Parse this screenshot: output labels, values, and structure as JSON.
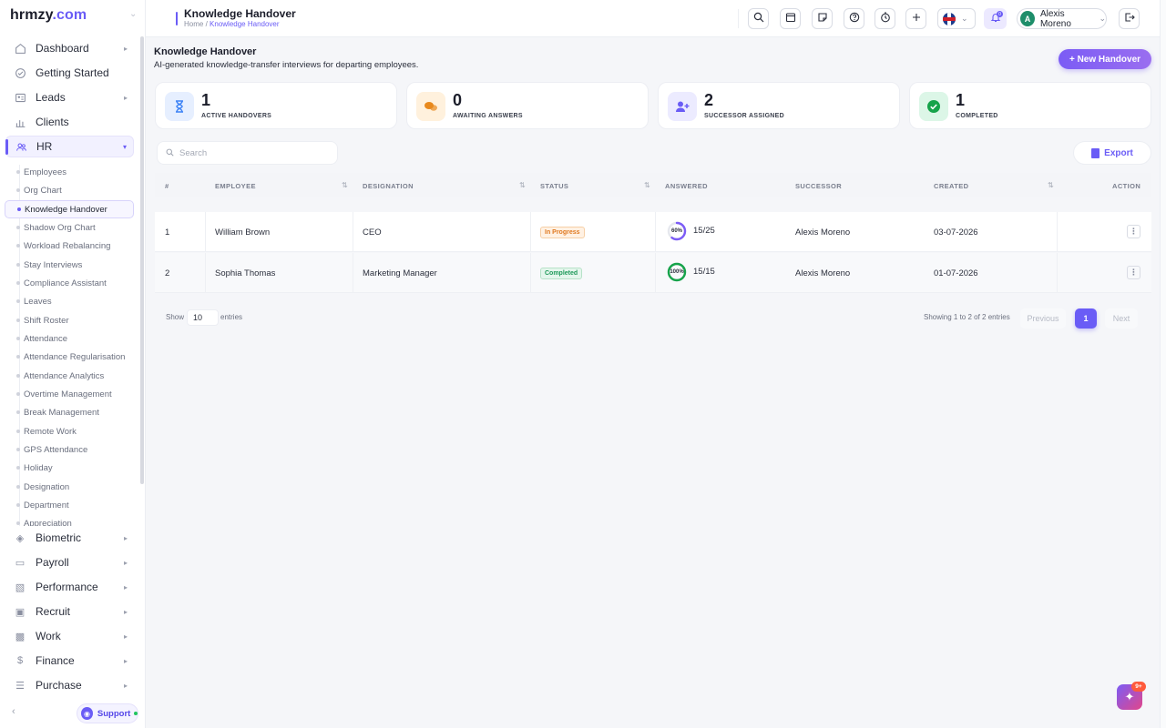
{
  "brand": {
    "name": "hrmzy",
    "suffix": ".com"
  },
  "header": {
    "title": "Knowledge Handover",
    "breadcrumb": [
      "Home",
      "Knowledge Handover"
    ],
    "user_name": "Alexis Moreno",
    "user_initial": "A",
    "notif_count": "0",
    "icons": [
      "search-icon",
      "calendar-icon",
      "notes-icon",
      "help-icon",
      "timer-icon",
      "plus-icon",
      "uk-flag-icon",
      "bell-icon",
      "logout-icon"
    ]
  },
  "sidebar": {
    "top_items": [
      {
        "label": "Dashboard",
        "icon": "home-icon",
        "has_arrow": true
      },
      {
        "label": "Getting Started",
        "icon": "check-circle-icon",
        "has_arrow": false
      },
      {
        "label": "Leads",
        "icon": "id-card-icon",
        "has_arrow": true
      },
      {
        "label": "Clients",
        "icon": "chart-icon",
        "has_arrow": false
      },
      {
        "label": "HR",
        "icon": "users-icon",
        "has_arrow": true,
        "active": true
      }
    ],
    "hr_items": [
      "Employees",
      "Org Chart",
      "Knowledge Handover",
      "Shadow Org Chart",
      "Workload Rebalancing",
      "Stay Interviews",
      "Compliance Assistant",
      "Leaves",
      "Shift Roster",
      "Attendance",
      "Attendance Regularisation",
      "Attendance Analytics",
      "Overtime Management",
      "Break Management",
      "Remote Work",
      "GPS Attendance",
      "Holiday",
      "Designation",
      "Department",
      "Appreciation"
    ],
    "hr_active": "Knowledge Handover",
    "bottom_items": [
      {
        "label": "Biometric",
        "icon": "fingerprint-icon"
      },
      {
        "label": "Payroll",
        "icon": "wallet-icon"
      },
      {
        "label": "Performance",
        "icon": "bars-icon"
      },
      {
        "label": "Recruit",
        "icon": "badge-icon"
      },
      {
        "label": "Work",
        "icon": "briefcase-icon"
      },
      {
        "label": "Finance",
        "icon": "dollar-icon"
      },
      {
        "label": "Purchase",
        "icon": "layers-icon"
      }
    ],
    "support_label": "Support"
  },
  "page": {
    "title": "Knowledge Handover",
    "subtitle": "AI-generated knowledge-transfer interviews for departing employees.",
    "new_button": "+ New Handover"
  },
  "stats": [
    {
      "value": "1",
      "label": "ACTIVE HANDOVERS",
      "icon": "hourglass-icon",
      "color": "#3b82f6",
      "bg": "#e6efff"
    },
    {
      "value": "0",
      "label": "AWAITING ANSWERS",
      "icon": "chat-icon",
      "color": "#e8891d",
      "bg": "#fff1dd"
    },
    {
      "value": "2",
      "label": "SUCCESSOR ASSIGNED",
      "icon": "user-plus-icon",
      "color": "#6a5cf6",
      "bg": "#ecebff"
    },
    {
      "value": "1",
      "label": "COMPLETED",
      "icon": "check-icon",
      "color": "#16a34a",
      "bg": "#dcf6e7"
    }
  ],
  "search": {
    "placeholder": "Search"
  },
  "export_label": "Export",
  "table": {
    "columns": [
      "#",
      "EMPLOYEE",
      "DESIGNATION",
      "STATUS",
      "ANSWERED",
      "SUCCESSOR",
      "CREATED",
      "ACTION"
    ],
    "rows": [
      {
        "num": "1",
        "employee": "William Brown",
        "designation": "CEO",
        "status": "In Progress",
        "status_type": "prog",
        "percent": 60,
        "percent_label": "60%",
        "answered": "15/25",
        "successor": "Alexis Moreno",
        "created": "03-07-2026",
        "ring_color": "#7c5cf6"
      },
      {
        "num": "2",
        "employee": "Sophia Thomas",
        "designation": "Marketing Manager",
        "status": "Completed",
        "status_type": "done",
        "percent": 100,
        "percent_label": "100%",
        "answered": "15/15",
        "successor": "Alexis Moreno",
        "created": "01-07-2026",
        "ring_color": "#16a34a"
      }
    ]
  },
  "footer": {
    "show": "Show",
    "length": "10",
    "entries": "entries",
    "info": "Showing 1 to 2 of 2 entries",
    "previous": "Previous",
    "current_page": "1",
    "next": "Next"
  },
  "fab_badge": "9+",
  "accent": "#6a5cf6"
}
